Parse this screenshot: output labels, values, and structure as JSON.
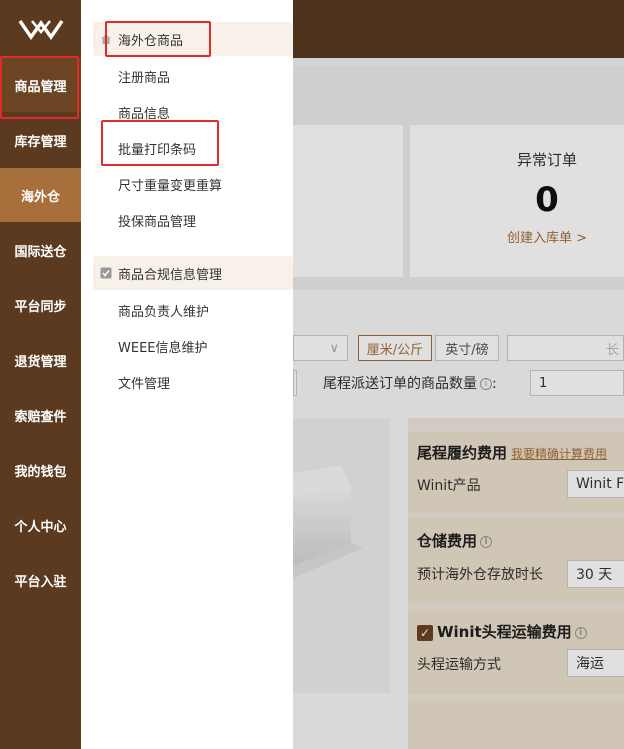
{
  "sidebar": {
    "logo_icon": "brand-logo-icon",
    "items": [
      {
        "label": "商品管理"
      },
      {
        "label": "库存管理"
      },
      {
        "label": "海外仓"
      },
      {
        "label": "国际送仓"
      },
      {
        "label": "平台同步"
      },
      {
        "label": "退货管理"
      },
      {
        "label": "索赔查件"
      },
      {
        "label": "我的钱包"
      },
      {
        "label": "个人中心"
      },
      {
        "label": "平台入驻"
      }
    ]
  },
  "flyout": {
    "group1": {
      "label": "海外仓商品",
      "icon": "home-icon"
    },
    "group1_items": [
      {
        "label": "注册商品"
      },
      {
        "label": "商品信息"
      },
      {
        "label": "批量打印条码"
      },
      {
        "label": "尺寸重量变更重算"
      },
      {
        "label": "投保商品管理"
      }
    ],
    "group2": {
      "label": "商品合规信息管理",
      "icon": "checkbox-icon"
    },
    "group2_items": [
      {
        "label": "商品负责人维护"
      },
      {
        "label": "WEEE信息维护"
      },
      {
        "label": "文件管理"
      }
    ]
  },
  "stat": {
    "title": "异常订单",
    "value": "0",
    "link": "创建入库单 >"
  },
  "calculator": {
    "unit_metric": "厘米/公斤",
    "unit_imperial": "英寸/磅",
    "length_placeholder": "长",
    "qty_label": "尾程派送订单的商品数量",
    "qty_info_icon": "info-icon",
    "qty_colon": ":",
    "qty_value": "1"
  },
  "fees": {
    "last_mile": {
      "title": "尾程履约费用",
      "link": "我要精确计算费用",
      "product_label": "Winit产品",
      "product_value": "Winit F"
    },
    "storage": {
      "title": "仓储费用",
      "duration_label": "预计海外仓存放时长",
      "duration_value": "30 天"
    },
    "first_leg": {
      "title": "Winit头程运输费用",
      "mode_label": "头程运输方式",
      "mode_value": "海运"
    }
  },
  "colors": {
    "sidebar_bg": "#5b3a1f",
    "accent": "#a66f3c",
    "highlight_box": "#e12b2b"
  }
}
